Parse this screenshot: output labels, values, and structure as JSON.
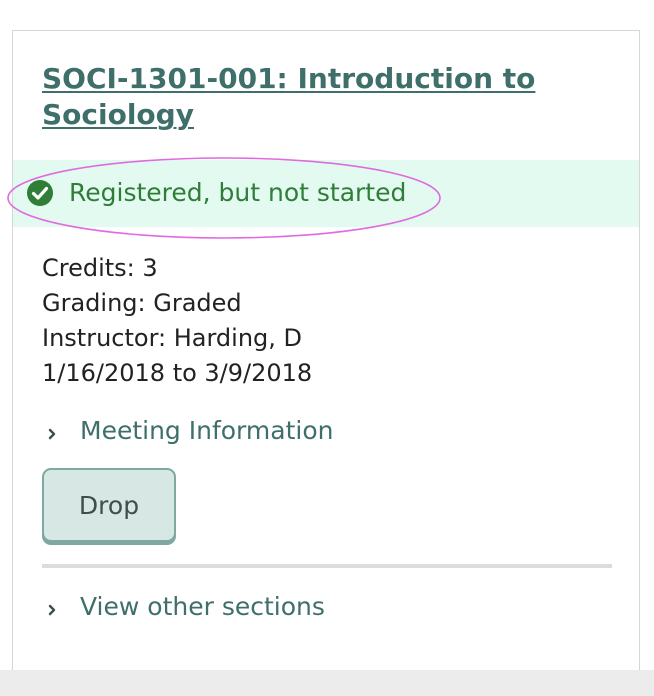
{
  "course": {
    "title": "SOCI-1301-001: Introduction to Sociology"
  },
  "status": {
    "text": "Registered, but not started",
    "icon": "check-circle-icon",
    "color": "#2f7d37",
    "banner_color": "#e3faf1"
  },
  "details": {
    "credits": "Credits: 3",
    "grading": "Grading: Graded",
    "instructor": "Instructor: Harding, D",
    "dates": "1/16/2018 to 3/9/2018"
  },
  "meeting_info": {
    "label": "Meeting Information",
    "icon": "chevron-right-icon"
  },
  "actions": {
    "drop_label": "Drop"
  },
  "other_sections": {
    "label": "View other sections",
    "icon": "chevron-right-icon"
  },
  "theme": {
    "accent": "#3f6f6a",
    "highlight_annotation": "#e06ae0"
  }
}
